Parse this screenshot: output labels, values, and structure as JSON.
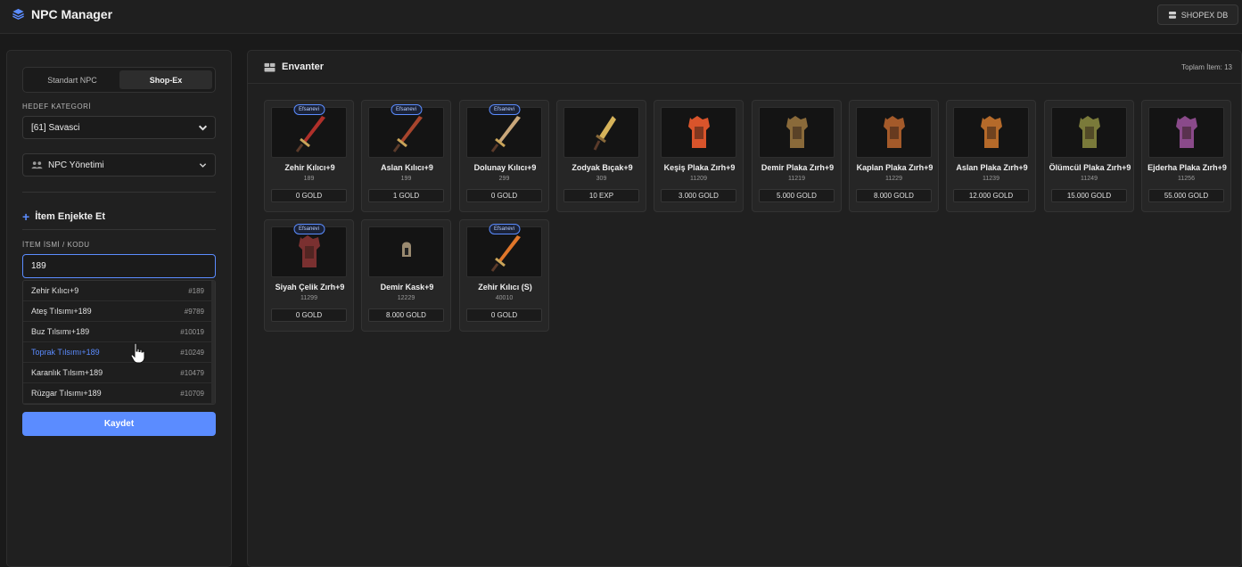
{
  "header": {
    "title": "NPC Manager",
    "db_button": "SHOPEX DB"
  },
  "sidebar": {
    "tabs": [
      "Standart NPC",
      "Shop-Ex"
    ],
    "active_tab": "Shop-Ex",
    "category_label": "HEDEF KATEGORİ",
    "category_value": "[61] Savasci",
    "npc_menu_label": "NPC Yönetimi",
    "inject_title": "İtem Enjekte Et",
    "item_label": "İTEM İSMİ / KODU",
    "item_input_value": "189",
    "suggestions": [
      {
        "name": "Zehir Kılıcı+9",
        "code": "#189"
      },
      {
        "name": "Ateş Tılsımı+189",
        "code": "#9789"
      },
      {
        "name": "Buz Tılsımı+189",
        "code": "#10019"
      },
      {
        "name": "Toprak Tılsımı+189",
        "code": "#10249"
      },
      {
        "name": "Karanlık Tılsım+189",
        "code": "#10479"
      },
      {
        "name": "Rüzgar Tılsımı+189",
        "code": "#10709"
      }
    ],
    "save_label": "Kaydet"
  },
  "inventory": {
    "title": "Envanter",
    "total_label": "Toplam İtem: 13",
    "items": [
      {
        "name": "Zehir Kılıcı+9",
        "code": "189",
        "price": "0 GOLD",
        "badge": "Efsanevi",
        "icon": "sword-icon",
        "color": "#b0302a"
      },
      {
        "name": "Aslan Kılıcı+9",
        "code": "199",
        "price": "1 GOLD",
        "badge": "Efsanevi",
        "icon": "sword-icon",
        "color": "#a8452d"
      },
      {
        "name": "Dolunay Kılıcı+9",
        "code": "299",
        "price": "0 GOLD",
        "badge": "Efsanevi",
        "icon": "sword-icon",
        "color": "#c9a77a"
      },
      {
        "name": "Zodyak Bıçak+9",
        "code": "309",
        "price": "10 EXP",
        "badge": "",
        "icon": "dagger-icon",
        "color": "#d6b35a"
      },
      {
        "name": "Keşiş Plaka Zırh+9",
        "code": "11209",
        "price": "3.000 GOLD",
        "badge": "",
        "icon": "armor-icon",
        "color": "#d9542b"
      },
      {
        "name": "Demir Plaka Zırh+9",
        "code": "11219",
        "price": "5.000 GOLD",
        "badge": "",
        "icon": "armor-icon",
        "color": "#8a6a3a"
      },
      {
        "name": "Kaplan Plaka Zırh+9",
        "code": "11229",
        "price": "8.000 GOLD",
        "badge": "",
        "icon": "armor-icon",
        "color": "#a45a2a"
      },
      {
        "name": "Aslan Plaka Zırh+9",
        "code": "11239",
        "price": "12.000 GOLD",
        "badge": "",
        "icon": "armor-icon",
        "color": "#b56a2a"
      },
      {
        "name": "Ölümcül Plaka Zırh+9",
        "code": "11249",
        "price": "15.000 GOLD",
        "badge": "",
        "icon": "armor-icon",
        "color": "#7a7a3a"
      },
      {
        "name": "Ejderha Plaka Zırh+9",
        "code": "11256",
        "price": "55.000 GOLD",
        "badge": "",
        "icon": "armor-icon",
        "color": "#8a4a8a"
      },
      {
        "name": "Siyah Çelik Zırh+9",
        "code": "11299",
        "price": "0 GOLD",
        "badge": "Efsanevi",
        "icon": "armor-icon",
        "color": "#7a3030"
      },
      {
        "name": "Demir Kask+9",
        "code": "12229",
        "price": "8.000 GOLD",
        "badge": "",
        "icon": "helmet-icon",
        "color": "#9a8a70"
      },
      {
        "name": "Zehir Kılıcı (S)",
        "code": "40010",
        "price": "0 GOLD",
        "badge": "Efsanevi",
        "icon": "sword-icon",
        "color": "#e0762a"
      }
    ]
  }
}
